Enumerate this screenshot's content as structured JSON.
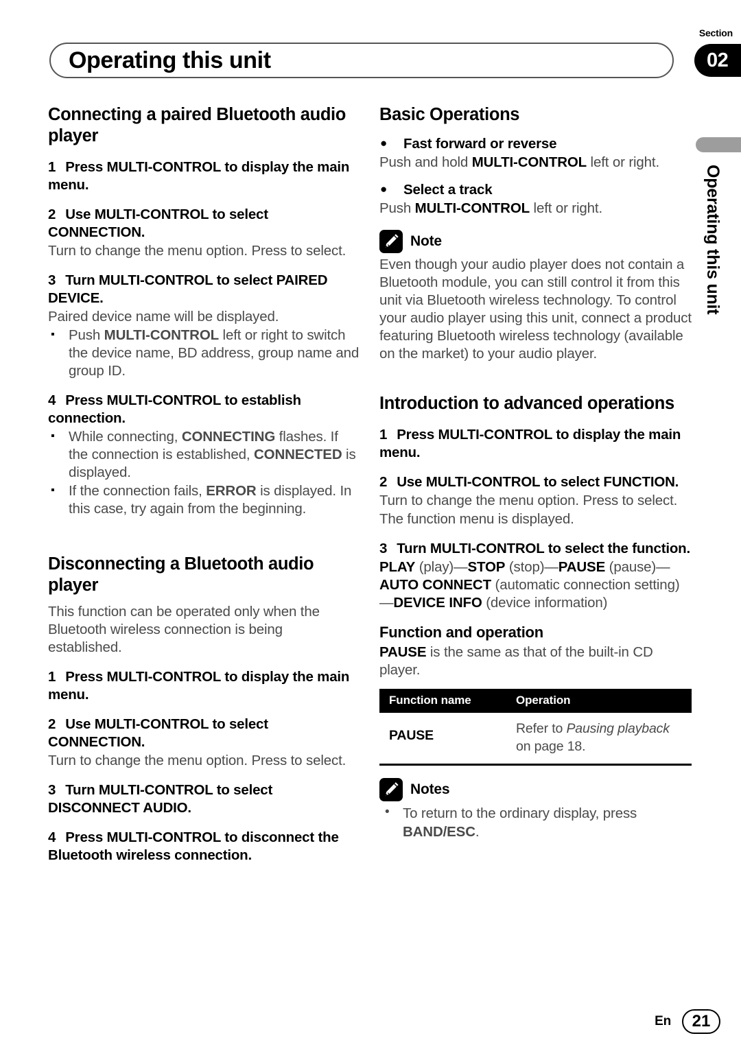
{
  "header": {
    "title": "Operating this unit",
    "section_label": "Section",
    "section_number": "02"
  },
  "side_tab": {
    "text": "Operating this unit"
  },
  "left_column": {
    "heading1": "Connecting a paired Bluetooth audio player",
    "s1_num": "1",
    "s1_text": "Press MULTI-CONTROL to display the main menu.",
    "s2_num": "2",
    "s2_text": "Use MULTI-CONTROL to select CONNECTION.",
    "s2_body": "Turn to change the menu option. Press to select.",
    "s3_num": "3",
    "s3_text": "Turn MULTI-CONTROL to select PAIRED DEVICE.",
    "s3_body": "Paired device name will be displayed.",
    "s3_bullet_a": "Push ",
    "s3_bullet_a_bold": "MULTI-CONTROL",
    "s3_bullet_a_rest": " left or right to switch the device name, BD address, group name and group ID.",
    "s4_num": "4",
    "s4_text": "Press MULTI-CONTROL to establish connection.",
    "s4_bullet_a_pre": "While connecting, ",
    "s4_bullet_a_bold": "CONNECTING",
    "s4_bullet_a_mid": " flashes. If the connection is established, ",
    "s4_bullet_a_bold2": "CONNECTED",
    "s4_bullet_a_post": " is displayed.",
    "s4_bullet_b_pre": "If the connection fails, ",
    "s4_bullet_b_bold": "ERROR",
    "s4_bullet_b_post": " is displayed. In this case, try again from the beginning.",
    "heading2": "Disconnecting a Bluetooth audio player",
    "h2_body": "This function can be operated only when the Bluetooth wireless connection is being established.",
    "d1_num": "1",
    "d1_text": "Press MULTI-CONTROL to display the main menu.",
    "d2_num": "2",
    "d2_text": "Use MULTI-CONTROL to select CONNECTION.",
    "d2_body": "Turn to change the menu option. Press to select.",
    "d3_num": "3",
    "d3_text": "Turn MULTI-CONTROL to select DISCONNECT AUDIO.",
    "d4_num": "4",
    "d4_text": "Press MULTI-CONTROL to disconnect the Bluetooth wireless connection."
  },
  "right_column": {
    "heading1": "Basic Operations",
    "op1_title": "Fast forward or reverse",
    "op1_body_pre": "Push and hold ",
    "op1_body_bold": "MULTI-CONTROL",
    "op1_body_post": " left or right.",
    "op2_title": "Select a track",
    "op2_body_pre": "Push ",
    "op2_body_bold": "MULTI-CONTROL",
    "op2_body_post": " left or right.",
    "note_title": "Note",
    "note_icon": "pencil-icon",
    "note_body": "Even though your audio player does not contain a Bluetooth module, you can still control it from this unit via Bluetooth wireless technology. To control your audio player using this unit, connect a product featuring Bluetooth wireless technology (available on the market) to your audio player.",
    "heading2": "Introduction to advanced operations",
    "a1_num": "1",
    "a1_text": "Press MULTI-CONTROL to display the main menu.",
    "a2_num": "2",
    "a2_text": "Use MULTI-CONTROL to select FUNCTION.",
    "a2_body": "Turn to change the menu option. Press to select.",
    "a2_body2": "The function menu is displayed.",
    "a3_num": "3",
    "a3_text": "Turn MULTI-CONTROL to select the function.",
    "a3_chain": [
      {
        "bold": "PLAY",
        "plain": " (play)"
      },
      {
        "dash": "—"
      },
      {
        "bold": "STOP",
        "plain": " (stop)"
      },
      {
        "dash": "—"
      },
      {
        "bold": "PAUSE",
        "plain": " (pause)"
      },
      {
        "dash": "—"
      },
      {
        "bold": "AUTO CONNECT",
        "plain": " (automatic connection setting)"
      },
      {
        "dash": "—"
      },
      {
        "bold": "DEVICE INFO",
        "plain": " (device information)"
      }
    ],
    "subheading": "Function and operation",
    "sub_body_bold": "PAUSE",
    "sub_body_rest": " is the same as that of the built-in CD player.",
    "table": {
      "columns": [
        "Function name",
        "Operation"
      ],
      "rows": [
        {
          "name": "PAUSE",
          "op_pre": "Refer to ",
          "op_italic": "Pausing playback",
          "op_post": " on page 18."
        }
      ]
    },
    "notes_title": "Notes",
    "notes_icon": "pencil-icon",
    "notes_items": [
      {
        "pre": "To return to the ordinary display, press ",
        "bold": "BAND/ESC",
        "post": "."
      }
    ]
  },
  "footer": {
    "language": "En",
    "page_number": "21"
  }
}
